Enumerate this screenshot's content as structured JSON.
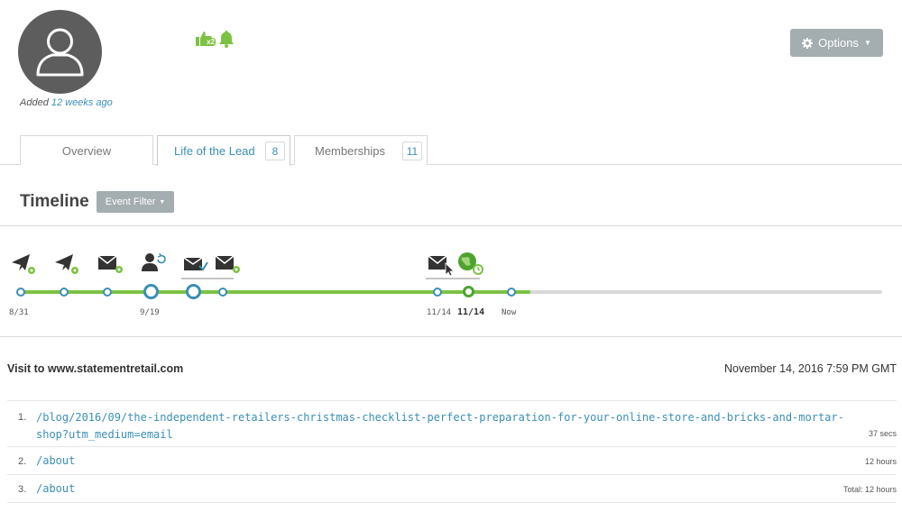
{
  "profile": {
    "added_prefix": "Added",
    "added_link": "12 weeks ago",
    "status_icons": [
      "thumbs-up-icon",
      "bell-icon"
    ],
    "thumbs_badge": "x2"
  },
  "header": {
    "options_label": "Options"
  },
  "tabs": [
    {
      "label": "Overview",
      "count": ""
    },
    {
      "label": "Life of the Lead",
      "count": "8",
      "active": true
    },
    {
      "label": "Memberships",
      "count": "11"
    }
  ],
  "timeline": {
    "title": "Timeline",
    "filter_label": "Event Filter",
    "events": [
      "email-sent-icon",
      "email-sent-icon",
      "email-gear-icon",
      "user-sync-icon",
      "email-opened-icon",
      "email-gear-icon",
      "email-click-icon",
      "web-visit-icon"
    ],
    "date_labels": [
      "8/31",
      "9/19",
      "11/14",
      "11/14",
      "Now"
    ]
  },
  "visit": {
    "title": "Visit to www.statementretail.com",
    "timestamp": "November 14, 2016 7:59 PM GMT",
    "pages": [
      {
        "index": "1.",
        "url": "/blog/2016/09/the-independent-retailers-christmas-checklist-perfect-preparation-for-your-online-store-and-bricks-and-mortar-shop?utm_medium=email",
        "duration": "37 secs"
      },
      {
        "index": "2.",
        "url": "/about",
        "duration": "12 hours"
      },
      {
        "index": "3.",
        "url": "/about",
        "duration": "Total: 12 hours"
      }
    ]
  },
  "colors": {
    "link": "#3a8fb7",
    "green": "#7cc242",
    "button": "#a4adb0",
    "avatar": "#5d5d5d"
  }
}
